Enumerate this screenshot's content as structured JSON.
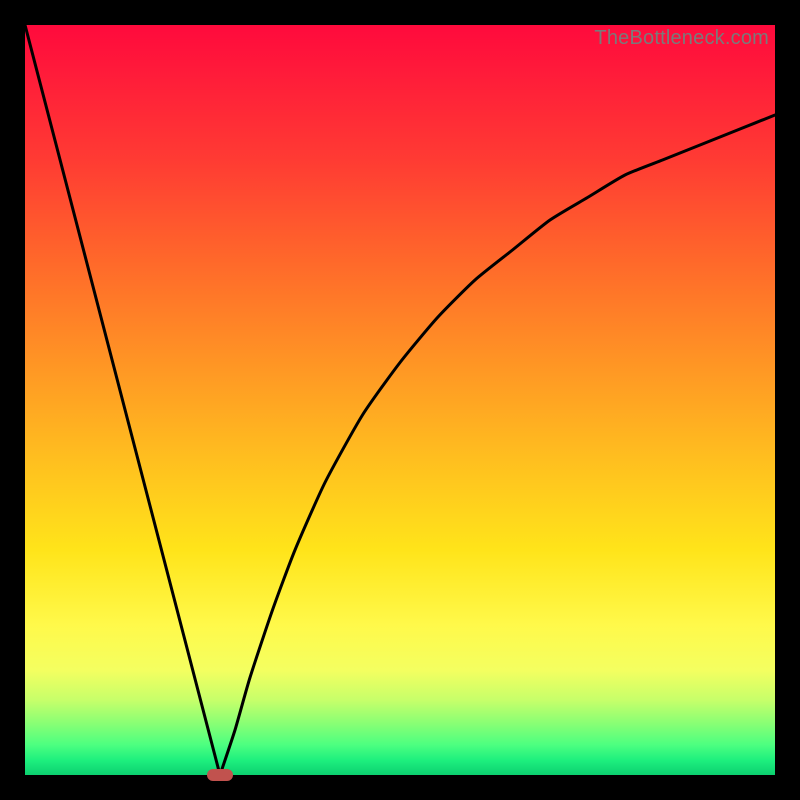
{
  "watermark": "TheBottleneck.com",
  "colors": {
    "frame": "#000000",
    "curve_stroke": "#000000",
    "marker_fill": "#c1524e",
    "gradient_top": "#ff0a3c",
    "gradient_bottom": "#0cd070"
  },
  "chart_data": {
    "type": "line",
    "title": "",
    "xlabel": "",
    "ylabel": "",
    "xlim": [
      0,
      100
    ],
    "ylim": [
      0,
      100
    ],
    "grid": false,
    "legend": false,
    "notes": "Bottleneck-style V curve. y approximates bottleneck percentage; x is a normalized parameter (0–100). Minimum y=0 at x≈26. Left branch is linear; right branch is concave rising toward ~88 at x=100. Gradient encodes y: green=good (low), red=bad (high).",
    "series": [
      {
        "name": "bottleneck_curve",
        "x": [
          0,
          5,
          10,
          15,
          20,
          25,
          26,
          28,
          30,
          33,
          36,
          40,
          45,
          50,
          55,
          60,
          65,
          70,
          75,
          80,
          85,
          90,
          95,
          100
        ],
        "y": [
          100,
          80.8,
          61.5,
          42.3,
          23.1,
          3.8,
          0,
          6,
          13,
          22,
          30,
          39,
          48,
          55,
          61,
          66,
          70,
          74,
          77,
          80,
          82,
          84,
          86,
          88
        ]
      }
    ],
    "marker": {
      "x": 26,
      "y": 0,
      "shape": "pill"
    }
  }
}
